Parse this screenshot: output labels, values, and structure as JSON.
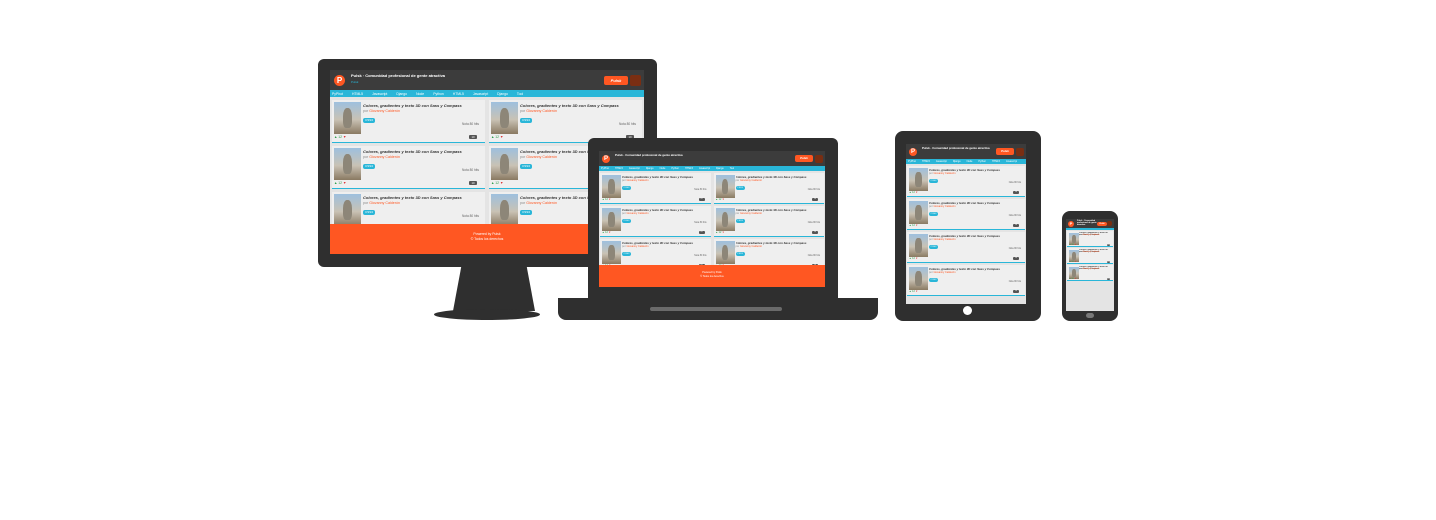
{
  "app": {
    "logo_letter": "P",
    "title": "Pulsk · Comunidad profesional de gente atractiva",
    "subtitle": "Pulsk",
    "brand": "Pulsk",
    "nav": [
      "PyPhot",
      "HTML5",
      "Javascript",
      "Django",
      "Node",
      "Python",
      "HTML5",
      "Javascript",
      "Django",
      "Tool"
    ],
    "card": {
      "title": "Colores, gradientes y texto 3D con Sass y Compass",
      "author_prefix": "por",
      "author": "Giovanny Calderón",
      "tag": "CSS3",
      "meta_label": "Nota",
      "meta_value": "80",
      "meta_unit": "hits",
      "votes": "12",
      "count": "10"
    },
    "footer_line1": "Powered by Pulsk",
    "footer_line2": "© Todos los derechos"
  }
}
